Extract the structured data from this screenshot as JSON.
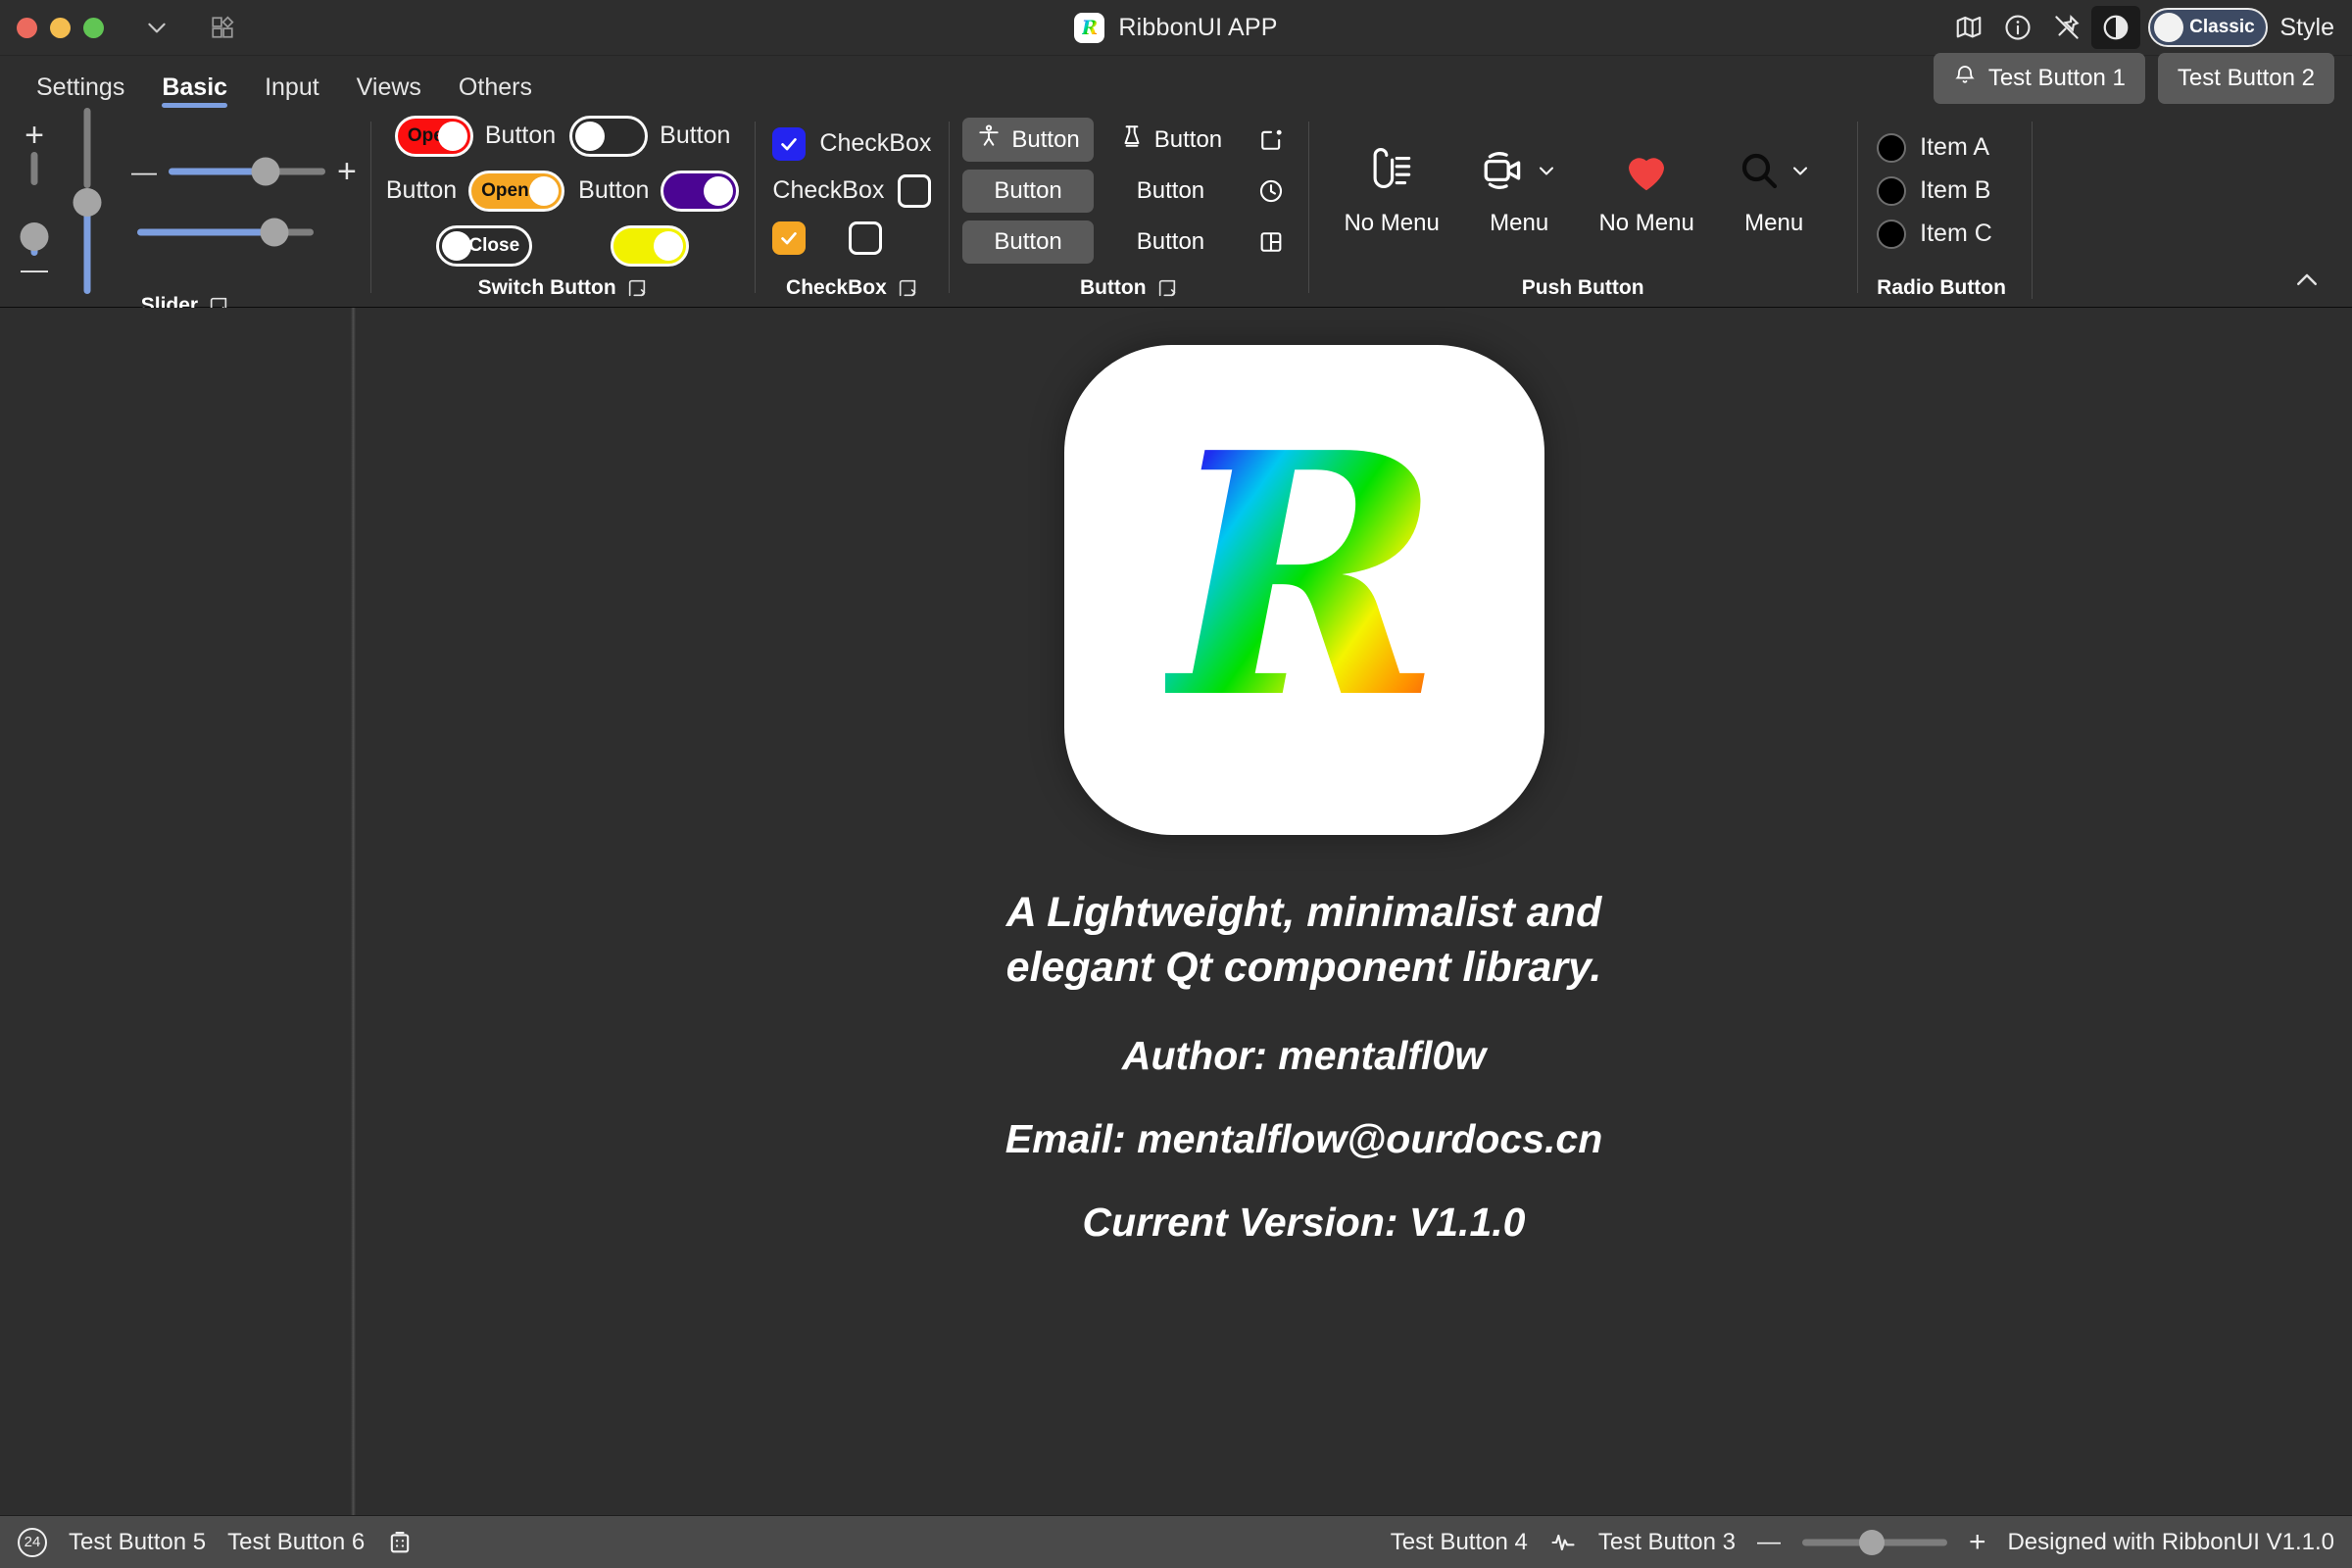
{
  "window": {
    "title": "RibbonUI APP",
    "traffic_lights": [
      "close",
      "minimize",
      "maximize"
    ],
    "colors": {
      "close": "#ec6a5e",
      "minimize": "#f4bd4f",
      "maximize": "#61c554",
      "accent": "#7d9fe0"
    }
  },
  "titlebar_right": {
    "icons": [
      "map-icon",
      "info-icon",
      "unpin-icon",
      "contrast-icon"
    ],
    "style_toggle_label": "Classic",
    "style_text": "Style"
  },
  "tabs": [
    {
      "label": "Settings",
      "active": false
    },
    {
      "label": "Basic",
      "active": true
    },
    {
      "label": "Input",
      "active": false
    },
    {
      "label": "Views",
      "active": false
    },
    {
      "label": "Others",
      "active": false
    }
  ],
  "tabbar_buttons": [
    {
      "label": "Test Button 1",
      "icon": "bell-icon"
    },
    {
      "label": "Test Button 2",
      "icon": ""
    }
  ],
  "ribbon": {
    "groups": [
      {
        "title": "Slider",
        "has_launcher": true,
        "sliders": {
          "vertical": [
            {
              "name": "vertical-slider-1",
              "value": 28,
              "has_plus_minus": true
            },
            {
              "name": "vertical-slider-2",
              "value": 52
            }
          ],
          "horizontal": [
            {
              "name": "horizontal-slider-1",
              "value": 62,
              "has_plus_minus": true
            },
            {
              "name": "horizontal-slider-2",
              "value": 78
            }
          ]
        }
      },
      {
        "title": "Switch Button",
        "has_launcher": true,
        "switches": [
          {
            "name": "switch-red",
            "text": "Open",
            "on": true,
            "color": "#fb0f0f",
            "label": "Button",
            "label_side": "right"
          },
          {
            "name": "switch-dark",
            "text": "",
            "on": false,
            "color": "#2b2b2b",
            "label": "Button",
            "label_side": "right"
          },
          {
            "name": "switch-orange",
            "text": "Open",
            "on": true,
            "color": "#f5a623",
            "label": "Button",
            "label_side": "left"
          },
          {
            "name": "switch-purple",
            "text": "",
            "on": true,
            "color": "#4b0593",
            "label": "Button",
            "label_side": "left"
          },
          {
            "name": "switch-close",
            "text": "Close",
            "on": false,
            "color": "#2b2b2b",
            "label": "",
            "label_side": "none"
          },
          {
            "name": "switch-yellow",
            "text": "",
            "on": true,
            "color": "#f2f200",
            "label": "",
            "label_side": "none"
          }
        ]
      },
      {
        "title": "CheckBox",
        "has_launcher": true,
        "checkboxes": [
          {
            "name": "checkbox-blue",
            "label": "CheckBox",
            "checked": true,
            "color": "#2424f0",
            "label_side": "right"
          },
          {
            "name": "checkbox-empty-1",
            "label": "CheckBox",
            "checked": false,
            "color": "",
            "label_side": "left"
          },
          {
            "name": "checkbox-orange",
            "label": "",
            "checked": true,
            "color": "#f5a623",
            "label_side": "none"
          },
          {
            "name": "checkbox-empty-2",
            "label": "",
            "checked": false,
            "color": "",
            "label_side": "none"
          }
        ]
      },
      {
        "title": "Button",
        "has_launcher": true,
        "buttons": [
          {
            "name": "button-accessibility",
            "label": "Button",
            "icon": "accessibility-icon",
            "style": "filled"
          },
          {
            "name": "button-flask",
            "label": "Button",
            "icon": "flask-icon",
            "style": "plain"
          },
          {
            "name": "button-notification-square",
            "label": "",
            "icon": "square-dot-icon",
            "style": "icon"
          },
          {
            "name": "button-plain-1",
            "label": "Button",
            "icon": "",
            "style": "filled"
          },
          {
            "name": "button-plain-2",
            "label": "Button",
            "icon": "",
            "style": "plain"
          },
          {
            "name": "button-clock",
            "label": "",
            "icon": "clock-icon",
            "style": "icon"
          },
          {
            "name": "button-plain-3",
            "label": "Button",
            "icon": "",
            "style": "filled"
          },
          {
            "name": "button-plain-4",
            "label": "Button",
            "icon": "",
            "style": "plain"
          },
          {
            "name": "button-layout",
            "label": "",
            "icon": "layout-icon",
            "style": "icon"
          }
        ]
      },
      {
        "title": "Push Button",
        "has_launcher": false,
        "items": [
          {
            "name": "push-attachment",
            "label": "No Menu",
            "icon": "attachment-list-icon",
            "has_menu": false,
            "color": "#ffffff"
          },
          {
            "name": "push-video",
            "label": "Menu",
            "icon": "video-camera-icon",
            "has_menu": true,
            "color": "#ffffff"
          },
          {
            "name": "push-heart",
            "label": "No Menu",
            "icon": "heart-icon",
            "has_menu": false,
            "color": "#f0413f"
          },
          {
            "name": "push-search",
            "label": "Menu",
            "icon": "search-icon",
            "has_menu": true,
            "color": "#0b0b0b"
          }
        ]
      },
      {
        "title": "Radio Button",
        "has_launcher": false,
        "radios": [
          {
            "name": "radio-item-a",
            "label": "Item A",
            "selected": false
          },
          {
            "name": "radio-item-b",
            "label": "Item B",
            "selected": false
          },
          {
            "name": "radio-item-c",
            "label": "Item C",
            "selected": false
          }
        ]
      }
    ],
    "collapse_icon": "chevron-up-icon"
  },
  "content": {
    "logo_letter": "R",
    "tagline_line1": "A Lightweight, minimalist and",
    "tagline_line2": "elegant Qt component library.",
    "author": "Author: mentalfl0w",
    "email": "Email: mentalflow@ourdocs.cn",
    "version": "Current Version: V1.1.0"
  },
  "statusbar": {
    "badge": "24",
    "left_buttons": [
      "Test Button 5",
      "Test Button 6"
    ],
    "left_icon": "calendar-grid-icon",
    "right_buttons": [
      "Test Button 4",
      "Test Button 3"
    ],
    "right_icon": "pulse-icon",
    "zoom": {
      "minus": "—",
      "plus": "+",
      "value": 48
    },
    "footer_text": "Designed with RibbonUI V1.1.0"
  }
}
